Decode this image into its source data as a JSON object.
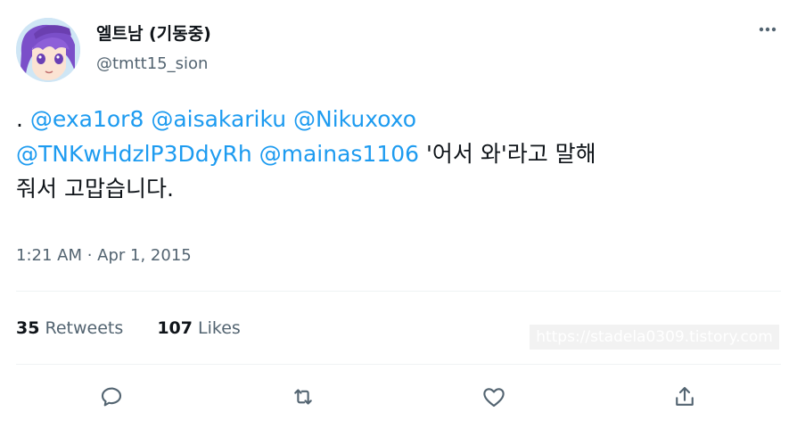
{
  "user": {
    "display_name": "엘트남 (기동중)",
    "handle": "@tmtt15_sion"
  },
  "tweet": {
    "line1_prefix": ". ",
    "mention1": "@exa1or8",
    "mention2": "@aisakariku",
    "mention3": "@Nikuxoxo",
    "mention4": "@TNKwHdzlP3DdyRh",
    "mention5": "@mainas1106",
    "line2_text": "'어서 와'라고 말해",
    "line3_text": "줘서 고맙습니다.",
    "timestamp": "1:21 AM · Apr 1, 2015"
  },
  "stats": {
    "retweets_count": "35",
    "retweets_label": "Retweets",
    "likes_count": "107",
    "likes_label": "Likes"
  },
  "watermark": "https://stadela0309.tistory.com",
  "colors": {
    "accent": "#1d9bf0",
    "secondary_text": "#536471",
    "divider": "#eff3f4"
  },
  "icons": {
    "more": "more-horizontal-icon",
    "reply": "reply-icon",
    "retweet": "retweet-icon",
    "like": "heart-icon",
    "share": "share-icon"
  }
}
